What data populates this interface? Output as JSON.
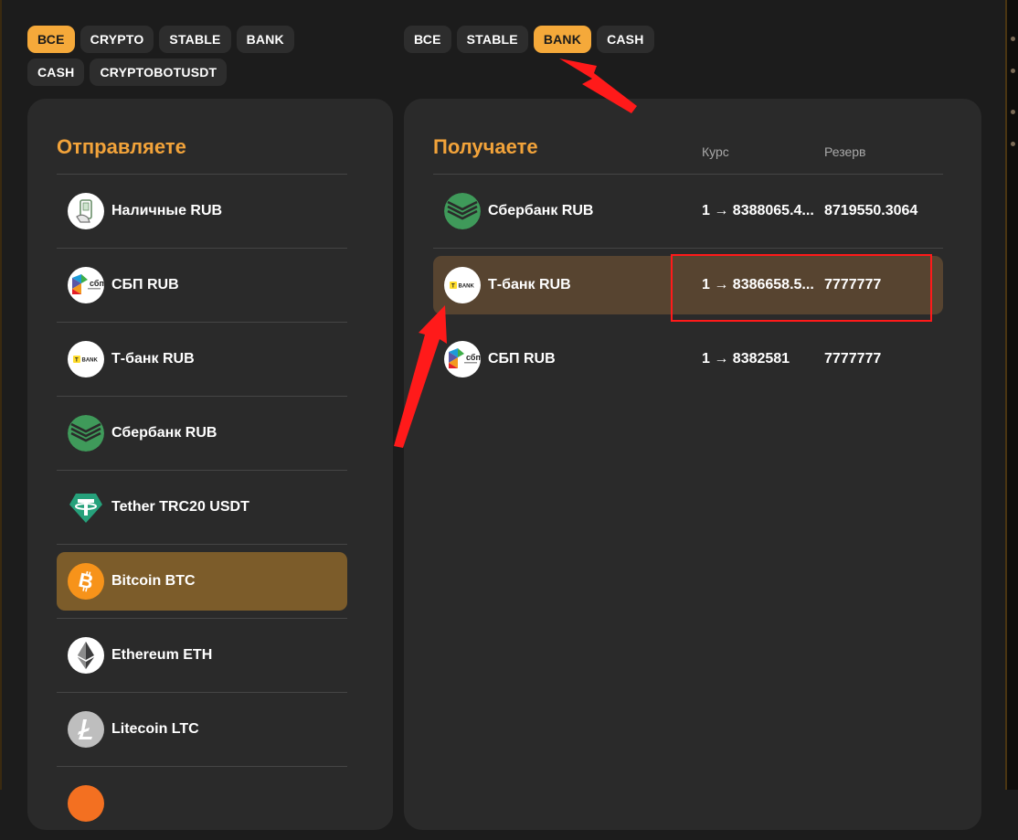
{
  "colors": {
    "accent": "#f5a93a",
    "panel": "#2a2a2a",
    "active_row_left": "#7c5c2a",
    "active_row_right": "#574430",
    "annotation": "#ff1a1a"
  },
  "left_filters": [
    {
      "label": "ВСЕ",
      "active": true
    },
    {
      "label": "CRYPTO",
      "active": false
    },
    {
      "label": "STABLE",
      "active": false
    },
    {
      "label": "BANK",
      "active": false
    },
    {
      "label": "CASH",
      "active": false
    },
    {
      "label": "CRYPTOBOTUSDT",
      "active": false
    }
  ],
  "right_filters": [
    {
      "label": "ВСЕ",
      "active": false
    },
    {
      "label": "STABLE",
      "active": false
    },
    {
      "label": "BANK",
      "active": true
    },
    {
      "label": "CASH",
      "active": false
    }
  ],
  "send_panel": {
    "title": "Отправляете",
    "items": [
      {
        "label": "Наличные RUB",
        "icon": "cash-hand-icon"
      },
      {
        "label": "СБП RUB",
        "icon": "sbp-icon"
      },
      {
        "label": "Т-банк RUB",
        "icon": "tbank-icon"
      },
      {
        "label": "Сбербанк RUB",
        "icon": "sberbank-icon"
      },
      {
        "label": "Tether TRC20 USDT",
        "icon": "tether-icon"
      },
      {
        "label": "Bitcoin BTC",
        "icon": "bitcoin-icon",
        "active": true
      },
      {
        "label": "Ethereum ETH",
        "icon": "ethereum-icon"
      },
      {
        "label": "Litecoin LTC",
        "icon": "litecoin-icon"
      }
    ]
  },
  "receive_panel": {
    "title": "Получаете",
    "col_rate": "Курс",
    "col_reserve": "Резерв",
    "items": [
      {
        "label": "Сбербанк RUB",
        "icon": "sberbank-icon",
        "rate": "1 → 8388065.4...",
        "reserve": "8719550.3064"
      },
      {
        "label": "Т-банк RUB",
        "icon": "tbank-icon",
        "rate": "1 → 8386658.5...",
        "reserve": "7777777",
        "active": true
      },
      {
        "label": "СБП RUB",
        "icon": "sbp-icon",
        "rate": "1 → 8382581",
        "reserve": "7777777"
      }
    ]
  }
}
